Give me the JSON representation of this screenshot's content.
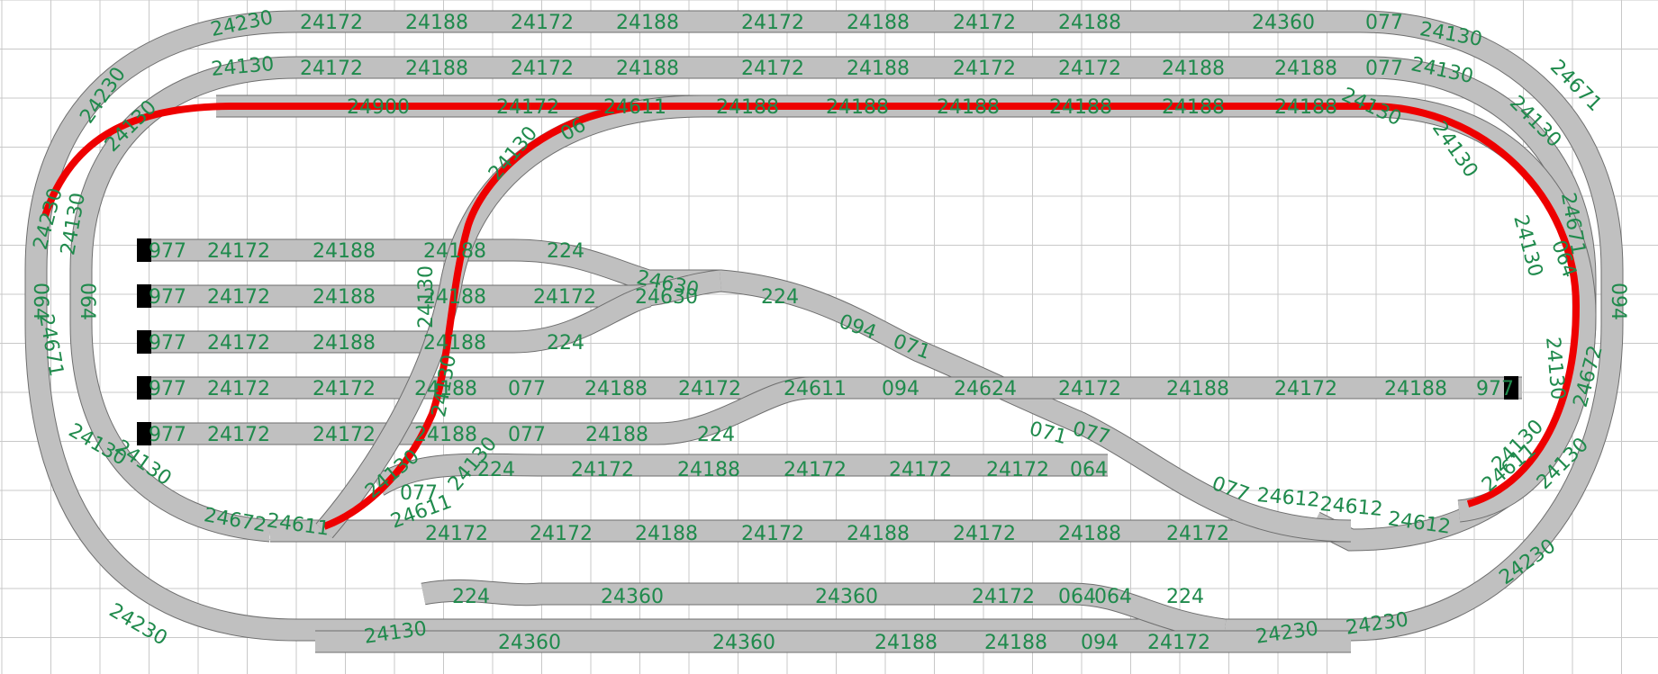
{
  "colors": {
    "background": "#ffffff",
    "grid": "#c8c8c8",
    "track_fill": "#c0c0c0",
    "track_edge": "#6e6e6e",
    "label": "#1f8a4c",
    "route": "#ee0000",
    "buffer": "#000000"
  },
  "stations": {
    "row1": [
      "24172",
      "24188",
      "24172",
      "24188",
      "24172",
      "24188",
      "24172",
      "24188",
      "24360",
      "077"
    ],
    "row2": [
      "24172",
      "24188",
      "24172",
      "24188",
      "24172",
      "24188",
      "24172",
      "24172",
      "24188",
      "24188",
      "077"
    ],
    "row_selected": [
      "24900",
      "24172",
      "24611",
      "24188",
      "24188",
      "24188",
      "24188",
      "24188",
      "24188"
    ],
    "yard1": [
      "977",
      "24172",
      "24188",
      "24188",
      "224"
    ],
    "yard2": [
      "977",
      "24172",
      "24188",
      "24188",
      "24172",
      "24630",
      "224"
    ],
    "yard3": [
      "977",
      "24172",
      "24188",
      "24188",
      "224"
    ],
    "main_mid": [
      "977",
      "24172",
      "24172",
      "24188",
      "077",
      "24188",
      "24172",
      "24611",
      "094",
      "24624",
      "24172",
      "24188",
      "24172",
      "24188",
      "977"
    ],
    "yard5": [
      "977",
      "24172",
      "24172",
      "24188",
      "077",
      "24188",
      "224"
    ],
    "row_lower": [
      "224",
      "24172",
      "24188",
      "24172",
      "24172",
      "24172",
      "064"
    ],
    "row_bottom_inner": [
      "24172",
      "24172",
      "24188",
      "24172",
      "24188",
      "24172",
      "24188",
      "24172"
    ],
    "row_bottom2": [
      "224",
      "24360",
      "24360",
      "24172",
      "064",
      "064",
      "224"
    ],
    "row_bottom3": [
      "24360",
      "24360",
      "24188",
      "24188",
      "094",
      "24172"
    ],
    "curves": [
      "24230",
      "24130",
      "24230",
      "24130",
      "24230",
      "24130",
      "24230",
      "24130",
      "24230",
      "24611",
      "24612",
      "24230",
      "24230",
      "24612",
      "24671",
      "24672",
      "24611",
      "24672",
      "24671",
      "24130",
      "24130",
      "24130",
      "24130",
      "24671",
      "064",
      "064",
      "064",
      "094",
      "094",
      "071",
      "071",
      "077",
      "077",
      "077",
      "24611",
      "24130",
      "24130",
      "24130",
      "24130",
      "24130",
      "24130",
      "24130",
      "24130",
      "24130",
      "24130",
      "24130",
      "06",
      "24130",
      "24630",
      "24612"
    ]
  }
}
